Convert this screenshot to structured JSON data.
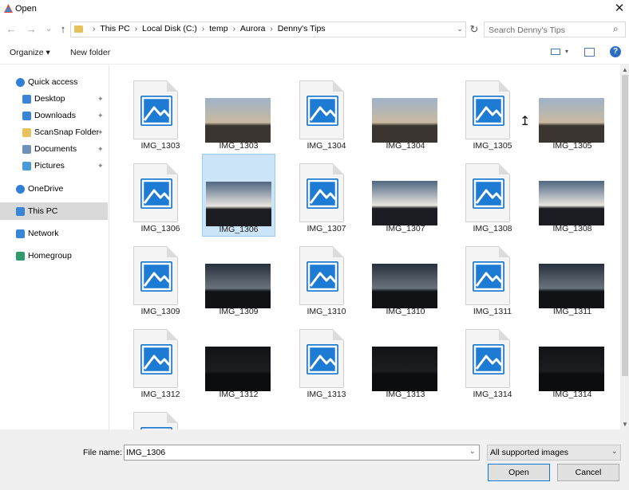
{
  "window": {
    "title": "Open",
    "close_glyph": "✕"
  },
  "nav": {
    "back_glyph": "←",
    "forward_glyph": "→",
    "recent_glyph": "⌄",
    "up_glyph": "↑",
    "breadcrumbs": [
      "This PC",
      "Local Disk (C:)",
      "temp",
      "Aurora",
      "Denny's Tips"
    ],
    "refresh_glyph": "↻",
    "search_placeholder": "Search Denny's Tips",
    "search_glyph": "⌕"
  },
  "toolbar": {
    "organize_label": "Organize ▾",
    "new_folder_label": "New folder",
    "view_dropdown_glyph": "▾",
    "help_glyph": "?"
  },
  "sidebar": {
    "items": [
      {
        "label": "Quick access",
        "icon": "star-icon",
        "pinned": false
      },
      {
        "label": "Desktop",
        "icon": "desktop-icon",
        "pinned": true
      },
      {
        "label": "Downloads",
        "icon": "download-icon",
        "pinned": true
      },
      {
        "label": "ScanSnap Folder",
        "icon": "folder-icon",
        "pinned": true
      },
      {
        "label": "Documents",
        "icon": "documents-icon",
        "pinned": true
      },
      {
        "label": "Pictures",
        "icon": "pictures-icon",
        "pinned": true
      },
      {
        "label": "OneDrive",
        "icon": "cloud-icon",
        "pinned": false
      },
      {
        "label": "This PC",
        "icon": "computer-icon",
        "pinned": false,
        "selected": true
      },
      {
        "label": "Network",
        "icon": "network-icon",
        "pinned": false
      },
      {
        "label": "Homegroup",
        "icon": "homegroup-icon",
        "pinned": false
      }
    ],
    "pin_glyph": "📌"
  },
  "files": [
    {
      "name": "IMG_1303",
      "kind": "icon"
    },
    {
      "name": "IMG_1303",
      "kind": "photo",
      "shade": "dusk"
    },
    {
      "name": "IMG_1304",
      "kind": "icon"
    },
    {
      "name": "IMG_1304",
      "kind": "photo",
      "shade": "dusk"
    },
    {
      "name": "IMG_1305",
      "kind": "icon"
    },
    {
      "name": "IMG_1305",
      "kind": "photo",
      "shade": "dusk"
    },
    {
      "name": "IMG_1306",
      "kind": "icon"
    },
    {
      "name": "IMG_1306",
      "kind": "photo",
      "shade": "sunset",
      "selected": true
    },
    {
      "name": "IMG_1307",
      "kind": "icon"
    },
    {
      "name": "IMG_1307",
      "kind": "photo",
      "shade": "sunset"
    },
    {
      "name": "IMG_1308",
      "kind": "icon"
    },
    {
      "name": "IMG_1308",
      "kind": "photo",
      "shade": "sunset"
    },
    {
      "name": "IMG_1309",
      "kind": "icon"
    },
    {
      "name": "IMG_1309",
      "kind": "photo",
      "shade": "night"
    },
    {
      "name": "IMG_1310",
      "kind": "icon"
    },
    {
      "name": "IMG_1310",
      "kind": "photo",
      "shade": "night"
    },
    {
      "name": "IMG_1311",
      "kind": "icon"
    },
    {
      "name": "IMG_1311",
      "kind": "photo",
      "shade": "night"
    },
    {
      "name": "IMG_1312",
      "kind": "icon"
    },
    {
      "name": "IMG_1312",
      "kind": "photo",
      "shade": "dark"
    },
    {
      "name": "IMG_1313",
      "kind": "icon"
    },
    {
      "name": "IMG_1313",
      "kind": "photo",
      "shade": "dark"
    },
    {
      "name": "IMG_1314",
      "kind": "icon"
    },
    {
      "name": "IMG_1314",
      "kind": "photo",
      "shade": "dark"
    },
    {
      "name": "",
      "kind": "icon"
    },
    {
      "name": "",
      "kind": "photo",
      "shade": "black"
    }
  ],
  "footer": {
    "file_name_label": "File name:",
    "file_name_value": "IMG_1306",
    "dropdown_glyph": "⌄",
    "filter_value": "All supported images",
    "open_label": "Open",
    "cancel_label": "Cancel"
  },
  "scrollbar": {
    "up_glyph": "▲",
    "down_glyph": "▼"
  },
  "cursor_glyph": "⇱",
  "colors": {
    "accent": "#0078d7",
    "selection": "#cce4f7",
    "photo_icon_blue": "#1e7bd4"
  }
}
